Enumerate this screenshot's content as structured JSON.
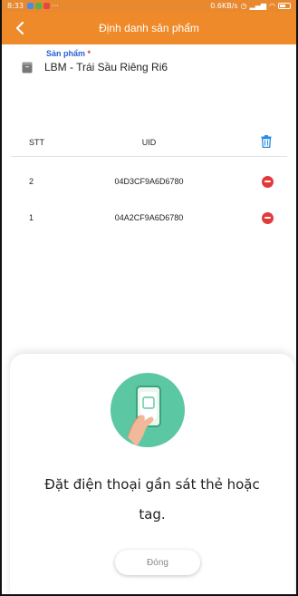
{
  "status_bar": {
    "time": "8:33",
    "speed": "0.6KB/s"
  },
  "header": {
    "title": "Định danh sản phẩm",
    "back_icon": "chevron-left-icon"
  },
  "product": {
    "label": "Sản phẩm",
    "required_mark": "*",
    "value": "LBM - Trái Sầu Riêng Ri6"
  },
  "table": {
    "columns": [
      "STT",
      "UID"
    ],
    "rows": [
      {
        "stt": "2",
        "uid": "04D3CF9A6D6780"
      },
      {
        "stt": "1",
        "uid": "04A2CF9A6D6780"
      }
    ]
  },
  "nfc_sheet": {
    "message_line1": "Đặt điện thoại gần sát thẻ hoặc",
    "message_line2": "tag.",
    "close_label": "Đóng"
  },
  "colors": {
    "header": "#ef8a2a",
    "accent_blue": "#2a62d4",
    "danger": "#e23a3a",
    "illustration_bg": "#5cc7a3"
  }
}
